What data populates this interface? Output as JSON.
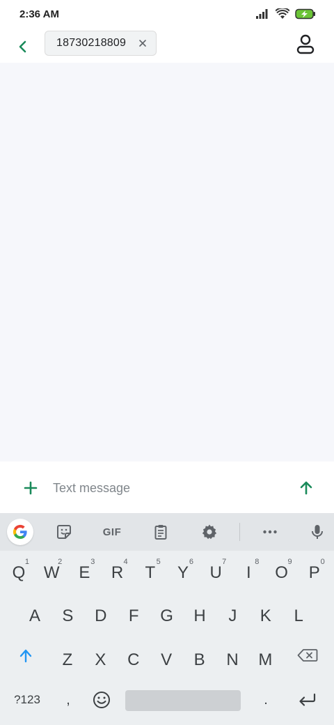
{
  "status_bar": {
    "time": "2:36 AM",
    "icons": [
      "signal-icon",
      "wifi-icon",
      "battery-charging-icon"
    ],
    "battery_color": "#6bc436"
  },
  "header": {
    "back_icon": "chevron-left-icon",
    "recipient": "18730218809",
    "contact_icon": "person-icon",
    "accent_color": "#1a8a5a"
  },
  "compose": {
    "placeholder": "Text message",
    "value": "",
    "attach_icon": "plus-icon",
    "send_icon": "arrow-up-icon"
  },
  "keyboard": {
    "toolbar": {
      "items": [
        "google-icon",
        "sticker-icon",
        "gif-icon",
        "clipboard-icon",
        "settings-icon",
        "more-icon",
        "mic-icon"
      ],
      "gif_label": "GIF"
    },
    "row1": [
      {
        "letter": "Q",
        "hint": "1"
      },
      {
        "letter": "W",
        "hint": "2"
      },
      {
        "letter": "E",
        "hint": "3"
      },
      {
        "letter": "R",
        "hint": "4"
      },
      {
        "letter": "T",
        "hint": "5"
      },
      {
        "letter": "Y",
        "hint": "6"
      },
      {
        "letter": "U",
        "hint": "7"
      },
      {
        "letter": "I",
        "hint": "8"
      },
      {
        "letter": "O",
        "hint": "9"
      },
      {
        "letter": "P",
        "hint": "0"
      }
    ],
    "row2": [
      "A",
      "S",
      "D",
      "F",
      "G",
      "H",
      "J",
      "K",
      "L"
    ],
    "row3": [
      "Z",
      "X",
      "C",
      "V",
      "B",
      "N",
      "M"
    ],
    "row4": {
      "symbols_label": "?123",
      "comma_label": ",",
      "period_label": "."
    }
  }
}
